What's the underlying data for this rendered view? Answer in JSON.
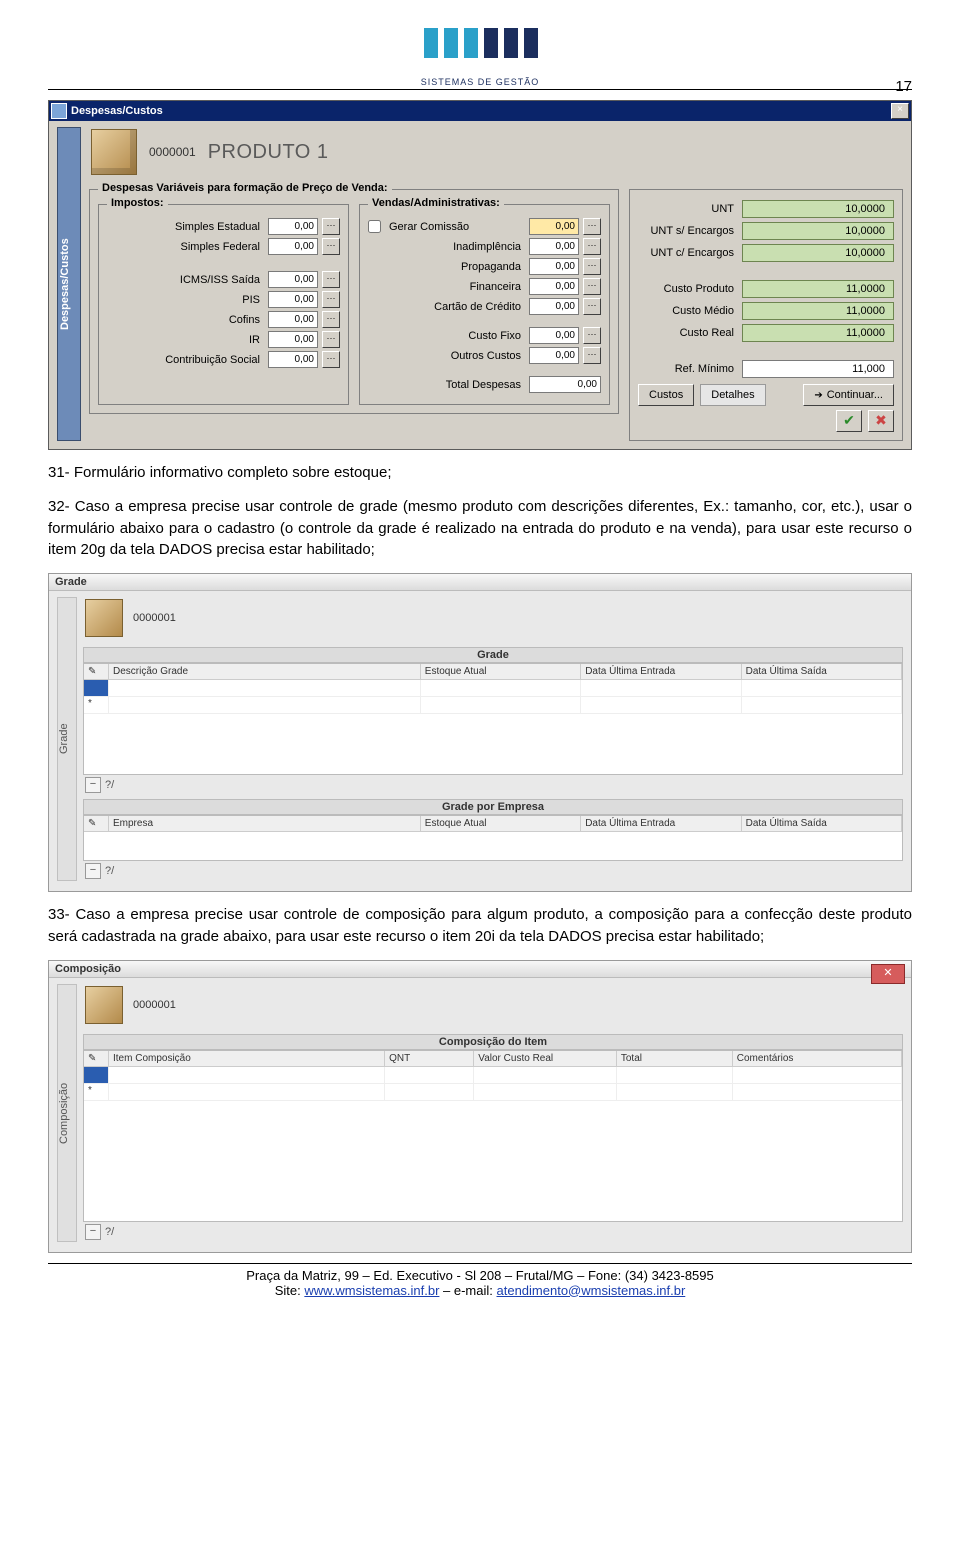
{
  "page_number": "17",
  "logo_text": "SISTEMAS DE GESTÃO",
  "win1": {
    "title": "Despesas/Custos",
    "vtab": "Despesas/Custos",
    "product_code": "0000001",
    "product_name": "PRODUTO 1",
    "group_title": "Despesas Variáveis para formação de Preço de Venda:",
    "impostos": {
      "legend": "Impostos:",
      "rows": [
        {
          "label": "Simples Estadual",
          "value": "0,00"
        },
        {
          "label": "Simples Federal",
          "value": "0,00"
        },
        {
          "label": "ICMS/ISS Saída",
          "value": "0,00"
        },
        {
          "label": "PIS",
          "value": "0,00"
        },
        {
          "label": "Cofins",
          "value": "0,00"
        },
        {
          "label": "IR",
          "value": "0,00"
        },
        {
          "label": "Contribuição Social",
          "value": "0,00"
        }
      ]
    },
    "vendas": {
      "legend": "Vendas/Administrativas:",
      "gerar_comissao_label": "Gerar Comissão",
      "gerar_comissao_value": "0,00",
      "rows": [
        {
          "label": "Inadimplência",
          "value": "0,00"
        },
        {
          "label": "Propaganda",
          "value": "0,00"
        },
        {
          "label": "Financeira",
          "value": "0,00"
        },
        {
          "label": "Cartão de Crédito",
          "value": "0,00"
        },
        {
          "label": "Custo Fixo",
          "value": "0,00"
        },
        {
          "label": "Outros Custos",
          "value": "0,00"
        }
      ],
      "total_label": "Total Despesas",
      "total_value": "0,00"
    },
    "readouts": {
      "unt": {
        "label": "UNT",
        "value": "10,0000"
      },
      "unt_s_encargos": {
        "label": "UNT s/ Encargos",
        "value": "10,0000"
      },
      "unt_c_encargos": {
        "label": "UNT c/ Encargos",
        "value": "10,0000"
      },
      "custo_produto": {
        "label": "Custo Produto",
        "value": "11,0000"
      },
      "custo_medio": {
        "label": "Custo Médio",
        "value": "11,0000"
      },
      "custo_real": {
        "label": "Custo Real",
        "value": "11,0000"
      },
      "ref_minimo": {
        "label": "Ref. Mínimo",
        "value": "11,000"
      }
    },
    "buttons": {
      "custos": "Custos",
      "detalhes": "Detalhes",
      "continuar": "Continuar..."
    }
  },
  "para1": "31- Formulário informativo completo sobre estoque;",
  "para2": "32- Caso a empresa precise usar controle de grade (mesmo produto com descrições diferentes, Ex.: tamanho, cor, etc.), usar o formulário abaixo para o cadastro (o controle da grade é realizado na entrada do produto e na venda), para usar este recurso o item 20g da tela DADOS precisa estar habilitado;",
  "win2": {
    "title": "Grade",
    "vtab": "Grade",
    "product_code": "0000001",
    "section1_title": "Grade",
    "cols1": [
      "Descrição Grade",
      "Estoque Atual",
      "Data Última Entrada",
      "Data Última Saída"
    ],
    "section2_title": "Grade por Empresa",
    "cols2": [
      "Empresa",
      "Estoque Atual",
      "Data Última Entrada",
      "Data Última Saída"
    ],
    "rowcount": "?/"
  },
  "para3": "33- Caso a empresa precise usar controle de composição para algum produto, a composição para a confecção deste produto será cadastrada na grade abaixo, para usar este recurso o item 20i da tela DADOS precisa estar habilitado;",
  "win3": {
    "title": "Composição",
    "vtab": "Composição",
    "product_code": "0000001",
    "section_title": "Composição do Item",
    "cols": [
      "Item Composição",
      "QNT",
      "Valor Custo Real",
      "Total",
      "Comentários"
    ],
    "rowcount": "?/"
  },
  "footer": {
    "line1": "Praça da Matriz, 99 – Ed. Executivo - Sl 208 – Frutal/MG – Fone: (34) 3423-8595",
    "site_label": "Site: ",
    "site": "www.wmsistemas.inf.br",
    "sep": " – e-mail: ",
    "email": "atendimento@wmsistemas.inf.br"
  }
}
